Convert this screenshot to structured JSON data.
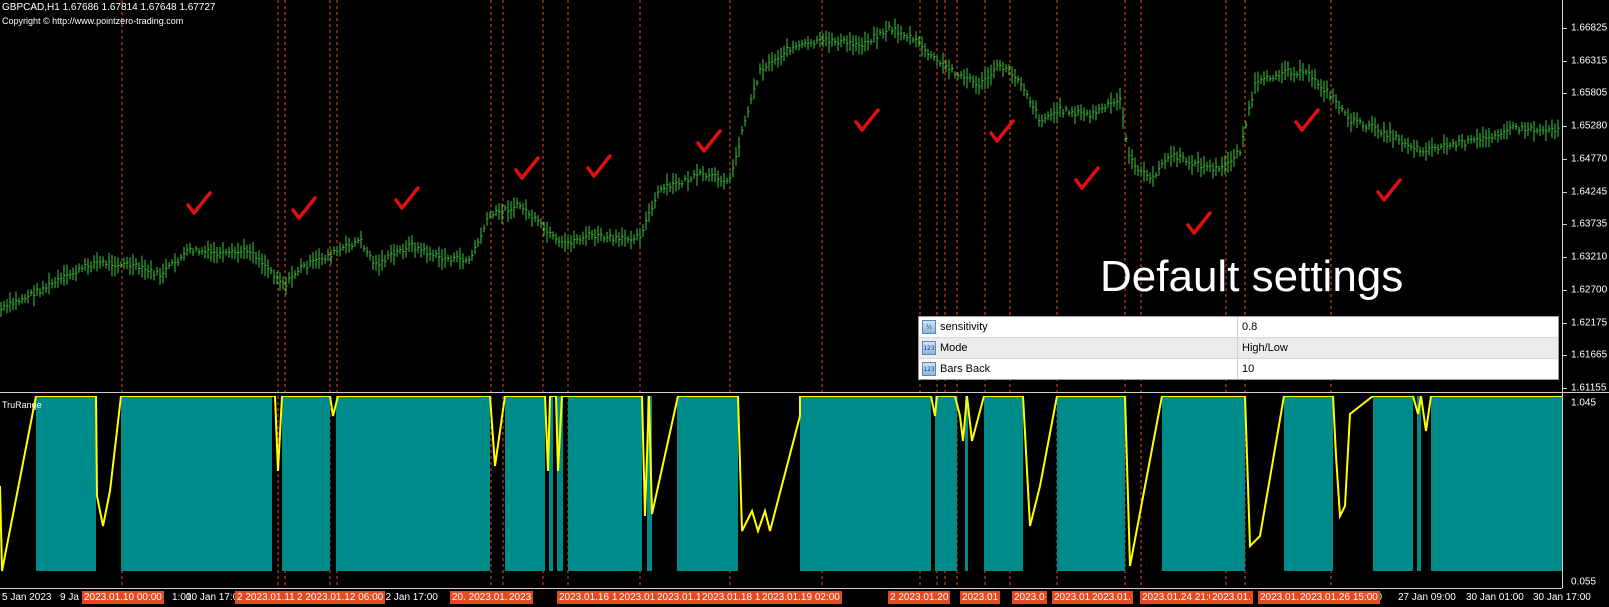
{
  "header": {
    "title": "GBPCAD,H1  1.67686 1.67814 1.67648 1.67727",
    "copyright": "Copyright © http://www.pointzero-trading.com"
  },
  "caption": "Default settings",
  "indicator": {
    "name": "TruRange",
    "scale_max_label": "1.045",
    "scale_min_label": "0.055"
  },
  "price_axis": {
    "labels": [
      "1.66825",
      "1.66315",
      "1.65805",
      "1.65280",
      "1.64770",
      "1.64245",
      "1.63735",
      "1.63210",
      "1.62700",
      "1.62175",
      "1.61665",
      "1.61155"
    ]
  },
  "inputs": [
    {
      "name": "sensitivity",
      "value": "0.8",
      "icon": "fraction-icon",
      "icon_text": "½"
    },
    {
      "name": "Mode",
      "value": "High/Low",
      "icon": "integer-icon",
      "icon_text": "123"
    },
    {
      "name": "Bars Back",
      "value": "10",
      "icon": "integer-icon",
      "icon_text": "123"
    }
  ],
  "time_axis": {
    "labels": [
      "5 Jan 2023",
      "9 Ja",
      "1:00",
      "10 Jan 17:00",
      "12 Jan 17:00",
      "17:00",
      "27 Jan 09:00",
      "30 Jan 01:00",
      "30 Jan 17:00",
      "Jan 09:00"
    ],
    "highlights": [
      "2023.01.10 00:00",
      "2 2023.01.11",
      "2 2023.01.12 06:00",
      "20. 2023.01.",
      "2023",
      "2023.01.16 16:0",
      "2023.01",
      "2023.01.17 1",
      "2023.01.18 10",
      "2023.01.19 02:00",
      "2 2023.01.20",
      "2023.01",
      "2023.0",
      "2023.01.23 18:",
      "2023.01.",
      "2023.01.24 21:00",
      "2023.01.",
      "2023.01.26",
      "2023.01.26 15:00"
    ]
  },
  "colors": {
    "background": "#000000",
    "price_bars": "#3cc83c",
    "vertical_markers": "#e8501e",
    "indicator_fill": "#008b8b",
    "indicator_line": "#ffff00",
    "check_marks": "#e01010",
    "axis_text": "#ffffff"
  }
}
